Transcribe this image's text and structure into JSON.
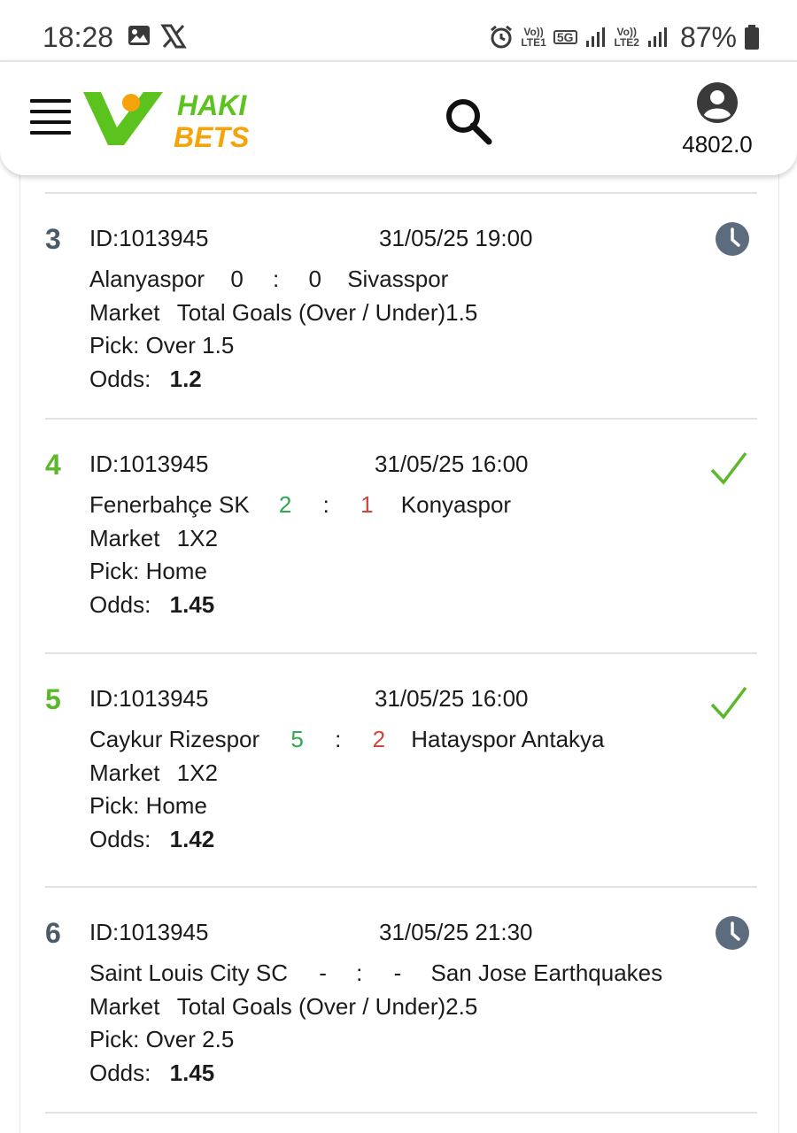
{
  "status_bar": {
    "time": "18:28",
    "lte1_top": "Vo))",
    "lte1_bottom": "LTE1",
    "net": "5G",
    "lte2_top": "Vo))",
    "lte2_bottom": "LTE2",
    "battery": "87%"
  },
  "header": {
    "logo_top": "HAKI",
    "logo_bottom": "BETS",
    "balance": "4802.0",
    "brand_green": "#5cc21e",
    "brand_orange": "#f5a30a"
  },
  "bets": [
    {
      "number": "3",
      "id": "ID:1013945",
      "date": "31/05/25 19:00",
      "home": "Alanyaspor",
      "home_score": "0",
      "sep": ":",
      "away_score": "0",
      "away": "Sivasspor",
      "market_label": "Market",
      "market": "Total Goals (Over / Under)1.5",
      "pick": "Pick: Over 1.5",
      "odds_label": "Odds:",
      "odds": "1.2",
      "status": "pending-clock-icon"
    },
    {
      "number": "4",
      "id": "ID:1013945",
      "date": "31/05/25 16:00",
      "home": "Fenerbahçe SK",
      "home_score": "2",
      "sep": ":",
      "away_score": "1",
      "away": "Konyaspor",
      "market_label": "Market",
      "market": "1X2",
      "pick": "Pick: Home",
      "odds_label": "Odds:",
      "odds": "1.45",
      "status": "won-check-icon"
    },
    {
      "number": "5",
      "id": "ID:1013945",
      "date": "31/05/25 16:00",
      "home": "Caykur Rizespor",
      "home_score": "5",
      "sep": ":",
      "away_score": "2",
      "away": "Hatayspor Antakya",
      "market_label": "Market",
      "market": "1X2",
      "pick": "Pick: Home",
      "odds_label": "Odds:",
      "odds": "1.42",
      "status": "won-check-icon"
    },
    {
      "number": "6",
      "id": "ID:1013945",
      "date": "31/05/25 21:30",
      "home": "Saint Louis City SC",
      "home_score": "-",
      "sep": ":",
      "away_score": "-",
      "away": "San Jose Earthquakes",
      "market_label": "Market",
      "market": "Total Goals (Over / Under)2.5",
      "pick": "Pick: Over 2.5",
      "odds_label": "Odds:",
      "odds": "1.45",
      "status": "pending-clock-icon"
    }
  ]
}
